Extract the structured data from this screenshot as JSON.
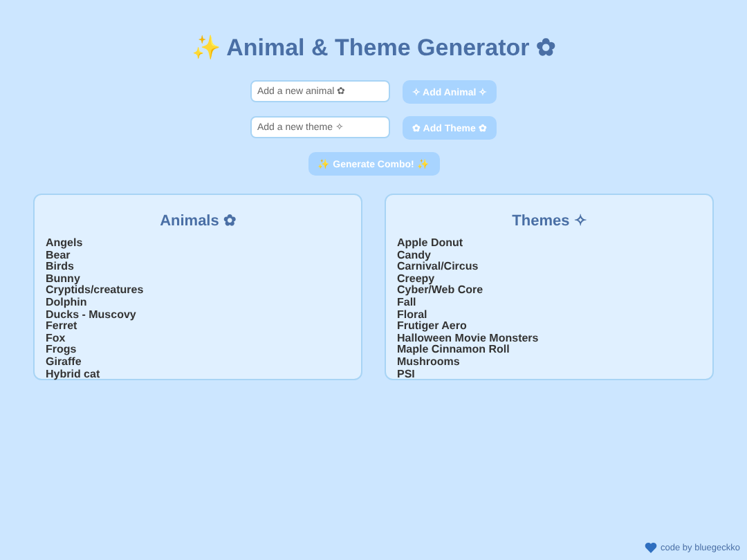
{
  "title": "✨ Animal & Theme Generator ✿",
  "inputs": [
    {
      "placeholder": "Add a new animal ✿",
      "button": "✧ Add Animal ✧"
    },
    {
      "placeholder": "Add a new theme ✧",
      "button": "✿ Add Theme ✿"
    }
  ],
  "generate_button": "✨ Generate Combo! ✨",
  "panels": [
    {
      "title": "Animals ✿",
      "items": [
        "Angels",
        "Bear",
        "Birds",
        "Bunny",
        "Cryptids/creatures",
        "Dolphin",
        "Ducks - Muscovy",
        "Ferret",
        "Fox",
        "Frogs",
        "Giraffe",
        "Hybrid cat"
      ]
    },
    {
      "title": "Themes ✧",
      "items": [
        "Apple Donut",
        "Candy",
        "Carnival/Circus",
        "Creepy",
        "Cyber/Web Core",
        "Fall",
        "Floral",
        "Frutiger Aero",
        "Halloween Movie Monsters",
        "Maple Cinnamon Roll",
        "Mushrooms",
        "PSI"
      ]
    }
  ],
  "footer": "code by bluegeckko"
}
